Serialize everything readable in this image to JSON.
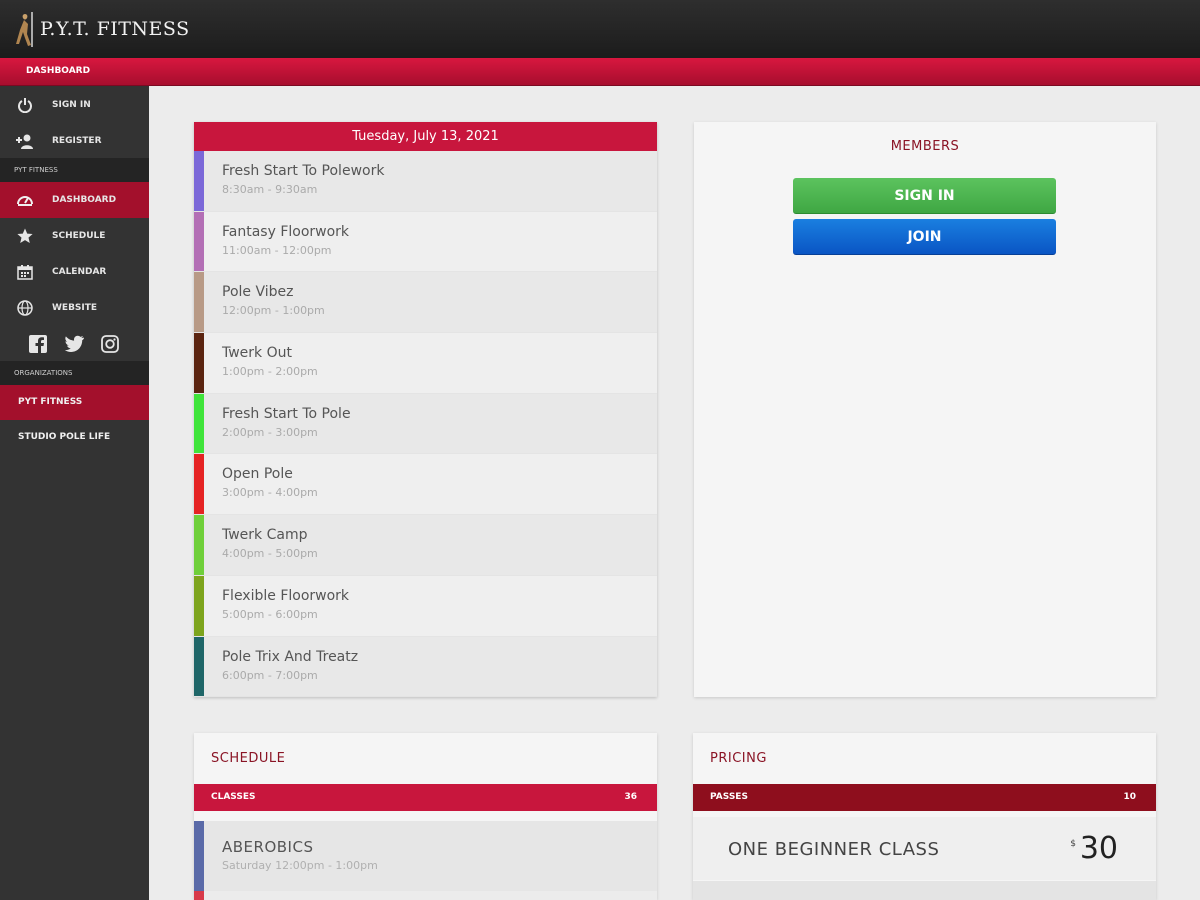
{
  "header": {
    "logo_text": "P.Y.T. FITNESS",
    "breadcrumb": "DASHBOARD"
  },
  "sidebar": {
    "top_items": [
      {
        "label": "SIGN IN",
        "icon": "power-icon"
      },
      {
        "label": "REGISTER",
        "icon": "add-user-icon"
      }
    ],
    "section_pyt": "PYT FITNESS",
    "nav_items": [
      {
        "label": "DASHBOARD",
        "icon": "gauge-icon",
        "active": true
      },
      {
        "label": "SCHEDULE",
        "icon": "star-icon"
      },
      {
        "label": "CALENDAR",
        "icon": "calendar-icon"
      },
      {
        "label": "WEBSITE",
        "icon": "globe-icon"
      }
    ],
    "social": [
      "facebook-icon",
      "twitter-icon",
      "instagram-icon"
    ],
    "section_orgs": "ORGANIZATIONS",
    "orgs": [
      {
        "label": "PYT FITNESS",
        "active": true
      },
      {
        "label": "STUDIO POLE LIFE"
      }
    ]
  },
  "day": {
    "date": "Tuesday, July 13, 2021",
    "classes": [
      {
        "name": "Fresh Start To Polework",
        "time": "8:30am - 9:30am",
        "color": "#7b68d8"
      },
      {
        "name": "Fantasy Floorwork",
        "time": "11:00am - 12:00pm",
        "color": "#b36fb5"
      },
      {
        "name": "Pole Vibez",
        "time": "12:00pm - 1:00pm",
        "color": "#b89a86"
      },
      {
        "name": "Twerk Out",
        "time": "1:00pm - 2:00pm",
        "color": "#5b2410"
      },
      {
        "name": "Fresh Start To Pole",
        "time": "2:00pm - 3:00pm",
        "color": "#3fe43a"
      },
      {
        "name": "Open Pole",
        "time": "3:00pm - 4:00pm",
        "color": "#e52323"
      },
      {
        "name": "Twerk Camp",
        "time": "4:00pm - 5:00pm",
        "color": "#6fcf3a"
      },
      {
        "name": "Flexible Floorwork",
        "time": "5:00pm - 6:00pm",
        "color": "#7da41d"
      },
      {
        "name": "Pole Trix And Treatz",
        "time": "6:00pm - 7:00pm",
        "color": "#1f6668"
      }
    ]
  },
  "members": {
    "title": "MEMBERS",
    "sign_in": "SIGN IN",
    "join": "JOIN"
  },
  "schedule": {
    "title": "SCHEDULE",
    "bar_label": "CLASSES",
    "count": "36",
    "item": {
      "name": "ABEROBICS",
      "time": "Saturday 12:00pm - 1:00pm"
    }
  },
  "pricing": {
    "title": "PRICING",
    "bar_label": "PASSES",
    "count": "10",
    "item": {
      "name": "ONE BEGINNER CLASS",
      "currency": "$",
      "amount": "30"
    }
  }
}
